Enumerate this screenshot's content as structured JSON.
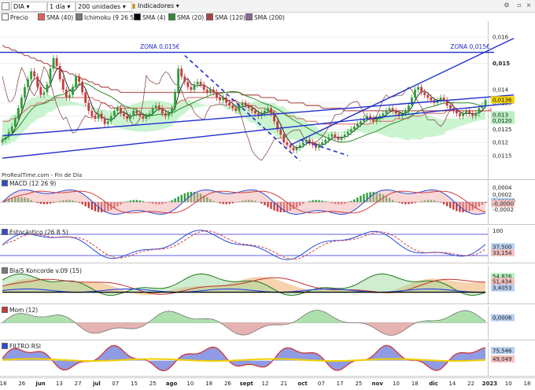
{
  "toolbar": {
    "symbol": "DIA",
    "period": "1 día",
    "units": "200 unidades",
    "indicators": "Indicadores"
  },
  "legend": [
    {
      "label": "Precio",
      "color": "#ffffff"
    },
    {
      "label": "SMA (40)",
      "color": "#e06060"
    },
    {
      "label": "Ichimoku (9 26 52)",
      "color": "#7a7a7a"
    },
    {
      "label": "SMA (4)",
      "color": "#000000"
    },
    {
      "label": "SMA (20)",
      "color": "#2e8b2e"
    },
    {
      "label": "SMA (120)",
      "color": "#b04040"
    },
    {
      "label": "SMA (200)",
      "color": "#8a6a9a"
    }
  ],
  "colors": {
    "up": "#2e9e3a",
    "down": "#c73a3a",
    "trendline": "#1f2ecc",
    "cloud_green": "#b8f0c0",
    "cloud_red": "#f4c0c0",
    "highlight": "#f5d400"
  },
  "watermark": "ProRealTime.com - Fin de Día",
  "x_axis_labels": [
    "18",
    "26",
    "jun",
    "13",
    "27",
    "jul",
    "07",
    "15",
    "25",
    "ago",
    "10",
    "18",
    "26",
    "sept",
    "12",
    "21",
    "oct",
    "07",
    "17",
    "25",
    "nov",
    "10",
    "18",
    "dic",
    "14",
    "22",
    "2023",
    "10",
    "18"
  ],
  "chart_data": [
    {
      "id": "price",
      "type": "candlestick",
      "title": "DIA",
      "ylim": [
        0.0106,
        0.0166
      ],
      "ticks": [
        "0,016",
        "0,015",
        "0,014",
        "0,0135",
        "0,013",
        "0,0125",
        "0,012",
        "0,0115"
      ],
      "tick_values": [
        0.016,
        0.015,
        0.014,
        0.0135,
        0.013,
        0.0125,
        0.012,
        0.0115
      ],
      "value_labels": [
        {
          "text": "0,0136",
          "value": 0.01362,
          "bg": "#f5d400"
        },
        {
          "text": "0,013",
          "value": 0.01305,
          "bg": "#b8f0c0"
        },
        {
          "text": "0,0120",
          "value": 0.01283,
          "bg": "#b8f0c0"
        }
      ],
      "annotations": [
        {
          "text": "ZONA 0,015€",
          "x": 45,
          "y": 0.01555
        },
        {
          "text": "ZONA 0,015€",
          "x": 142,
          "y": 0.01555
        }
      ],
      "horizontal_lines": [
        {
          "y": 0.01542,
          "color": "#1f2ecc"
        }
      ],
      "trendlines": [
        {
          "x0": 0,
          "y0": 0.0114,
          "x1": 160,
          "y1": 0.0135
        },
        {
          "x0": 0,
          "y0": 0.01225,
          "x1": 160,
          "y1": 0.0138
        },
        {
          "x0": 90,
          "y0": 0.0119,
          "x1": 160,
          "y1": 0.01595
        }
      ],
      "dashed_lines": [
        {
          "x0": 57,
          "y0": 0.0153,
          "x1": 93,
          "y1": 0.0113
        },
        {
          "x0": 93,
          "y0": 0.0121,
          "x1": 108,
          "y1": 0.0115
        }
      ],
      "close": [
        0.0121,
        0.0122,
        0.0124,
        0.0126,
        0.0129,
        0.0133,
        0.0137,
        0.0141,
        0.0144,
        0.0147,
        0.0145,
        0.0141,
        0.0138,
        0.0139,
        0.0142,
        0.0148,
        0.0152,
        0.0149,
        0.0144,
        0.014,
        0.0137,
        0.0138,
        0.0141,
        0.0145,
        0.0143,
        0.0139,
        0.0135,
        0.0132,
        0.013,
        0.0129,
        0.0131,
        0.0129,
        0.0127,
        0.0128,
        0.013,
        0.0132,
        0.0133,
        0.0131,
        0.013,
        0.0129,
        0.013,
        0.0132,
        0.0131,
        0.013,
        0.0129,
        0.013,
        0.0131,
        0.0133,
        0.0134,
        0.0133,
        0.0131,
        0.013,
        0.0131,
        0.0133,
        0.0139,
        0.0148,
        0.0145,
        0.0143,
        0.0141,
        0.014,
        0.0142,
        0.0143,
        0.0142,
        0.014,
        0.0139,
        0.014,
        0.0139,
        0.0137,
        0.0136,
        0.0137,
        0.0135,
        0.0134,
        0.0133,
        0.0132,
        0.0134,
        0.0135,
        0.0134,
        0.0133,
        0.0132,
        0.0131,
        0.013,
        0.0131,
        0.0132,
        0.0133,
        0.0131,
        0.0128,
        0.0125,
        0.0123,
        0.012,
        0.0119,
        0.0118,
        0.0117,
        0.0118,
        0.0119,
        0.012,
        0.0121,
        0.012,
        0.0119,
        0.0118,
        0.0119,
        0.012,
        0.0121,
        0.0122,
        0.0123,
        0.0122,
        0.0121,
        0.0122,
        0.0123,
        0.0124,
        0.0125,
        0.0126,
        0.0127,
        0.0128,
        0.0129,
        0.013,
        0.0129,
        0.0128,
        0.0129,
        0.013,
        0.0131,
        0.0132,
        0.0133,
        0.0132,
        0.0131,
        0.013,
        0.0131,
        0.0132,
        0.0134,
        0.0137,
        0.014,
        0.0141,
        0.0139,
        0.0138,
        0.0137,
        0.0136,
        0.0135,
        0.0136,
        0.0137,
        0.0136,
        0.0134,
        0.0133,
        0.0132,
        0.0131,
        0.013,
        0.0131,
        0.0132,
        0.0131,
        0.013,
        0.0131,
        0.0133,
        0.0134,
        0.0136
      ],
      "sma40": [
        0.0128,
        0.0128,
        0.0128,
        0.0129,
        0.0129,
        0.013,
        0.0131,
        0.0132,
        0.0133,
        0.0134,
        0.0134,
        0.0135,
        0.0135,
        0.0135,
        0.0136,
        0.0136,
        0.0136,
        0.0137,
        0.0137,
        0.0137,
        0.0137,
        0.0137,
        0.0137,
        0.0137,
        0.0137,
        0.0137,
        0.0137,
        0.0137,
        0.0137,
        0.0136,
        0.0136,
        0.0135,
        0.0135,
        0.0134,
        0.0134,
        0.0133,
        0.0133,
        0.0133,
        0.0133,
        0.0133,
        0.0133,
        0.0133,
        0.0133,
        0.0133,
        0.0133,
        0.0133,
        0.0133,
        0.0133,
        0.0133,
        0.0133,
        0.0133,
        0.0133,
        0.0133,
        0.0133,
        0.0134,
        0.0135,
        0.0136,
        0.0136,
        0.0137,
        0.0137,
        0.0137,
        0.0137,
        0.0137,
        0.0137,
        0.0137,
        0.0137,
        0.0137,
        0.0137,
        0.0137,
        0.0137,
        0.0136,
        0.0136,
        0.0136,
        0.0136,
        0.0135,
        0.0135,
        0.0135,
        0.0134,
        0.0134,
        0.0134,
        0.0133,
        0.0133,
        0.0133,
        0.0132,
        0.0132,
        0.0132,
        0.0131,
        0.0131,
        0.0131,
        0.013,
        0.013,
        0.013,
        0.0129,
        0.0129,
        0.0129,
        0.0128,
        0.0128,
        0.0128,
        0.0128,
        0.0127,
        0.0127,
        0.0127,
        0.0127,
        0.0127,
        0.0127,
        0.0127,
        0.0127,
        0.0127,
        0.0127,
        0.0127,
        0.0127,
        0.0127,
        0.0127,
        0.0127,
        0.0127,
        0.0127,
        0.0128,
        0.0128,
        0.0128,
        0.0128,
        0.0128,
        0.0128,
        0.0128,
        0.0129,
        0.0129,
        0.0129,
        0.0129,
        0.0129,
        0.013,
        0.013,
        0.013,
        0.013,
        0.0131,
        0.0131,
        0.0131,
        0.0131,
        0.0131,
        0.0131,
        0.0131,
        0.0132,
        0.0132,
        0.0132,
        0.0132,
        0.0132,
        0.0132,
        0.0132,
        0.0132,
        0.0132,
        0.0132,
        0.0132,
        0.0132,
        0.0132,
        0.0132,
        0.0133
      ],
      "sma120": [
        0.0157,
        0.0156,
        0.0156,
        0.0155,
        0.0155,
        0.0154,
        0.0154,
        0.0153,
        0.0153,
        0.0152,
        0.0152,
        0.0151,
        0.0151,
        0.015,
        0.015,
        0.0149,
        0.0149,
        0.0148,
        0.0148,
        0.0147,
        0.0147,
        0.0146,
        0.0146,
        0.0145,
        0.0145,
        0.0144,
        0.0144,
        0.0143,
        0.0143,
        0.0142,
        0.0142,
        0.0141,
        0.0141,
        0.0141,
        0.014,
        0.014,
        0.014,
        0.0139,
        0.0139,
        0.0139,
        0.0139,
        0.0139,
        0.0139,
        0.0139,
        0.0139,
        0.0139,
        0.0139,
        0.0139,
        0.0139,
        0.0139,
        0.0139,
        0.0139,
        0.0139,
        0.0139,
        0.0139,
        0.0139,
        0.0139,
        0.0139,
        0.0139,
        0.0139,
        0.0139,
        0.0139,
        0.0139,
        0.0139,
        0.0139,
        0.0139,
        0.0139,
        0.0139,
        0.0139,
        0.0139,
        0.0139,
        0.0139,
        0.0139,
        0.0139,
        0.0139,
        0.0138,
        0.0138,
        0.0138,
        0.0138,
        0.0138,
        0.0138,
        0.0137,
        0.0137,
        0.0137,
        0.0137,
        0.0137,
        0.0136,
        0.0136,
        0.0136,
        0.0136,
        0.0135,
        0.0135,
        0.0135,
        0.0135,
        0.0135,
        0.0134,
        0.0134,
        0.0134,
        0.0134,
        0.0134,
        0.0133,
        0.0133,
        0.0133,
        0.0133,
        0.0133,
        0.0133,
        0.0133,
        0.0132,
        0.0132,
        0.0132,
        0.0132,
        0.0132,
        0.0132,
        0.0132,
        0.0132,
        0.0132,
        0.0132,
        0.0132,
        0.0132,
        0.0132,
        0.0132,
        0.0132,
        0.0132,
        0.0132,
        0.0132,
        0.0132,
        0.0132,
        0.0132,
        0.0132,
        0.0132,
        0.0132,
        0.0132,
        0.0132,
        0.0132,
        0.0132,
        0.0132,
        0.0132,
        0.0132,
        0.0132,
        0.0132,
        0.0132,
        0.0132,
        0.0132,
        0.0132,
        0.0132,
        0.0132,
        0.0132,
        0.0132,
        0.0132,
        0.0132,
        0.0132,
        0.0132,
        0.0132,
        0.0132
      ]
    },
    {
      "id": "macd",
      "type": "histogram+lines",
      "title": "MACD (12 26 9)",
      "ylim": [
        -0.0006,
        0.0006
      ],
      "ticks": [
        "0,0004",
        "0,0002",
        "0,0000",
        "-0,0002"
      ],
      "tick_values": [
        0.0004,
        0.0002,
        0.0,
        -0.0002
      ],
      "value_labels": [
        {
          "text": "0,00000",
          "value": 2e-05,
          "bg": "#b8d0f0"
        },
        {
          "text": "-0,0000",
          "value": -4e-05,
          "bg": "#f4c0c0"
        }
      ]
    },
    {
      "id": "stoch",
      "type": "line",
      "title": "Estocástico (26 8 5)",
      "ylim": [
        0,
        100
      ],
      "ticks": [
        "100"
      ],
      "tick_values": [
        100
      ],
      "value_labels": [
        {
          "text": "37,500",
          "value": 45,
          "bg": "#b8d0f0"
        },
        {
          "text": "33,154",
          "value": 28,
          "bg": "#f4c0c0"
        }
      ],
      "levels": [
        80,
        20
      ]
    },
    {
      "id": "koncorde",
      "type": "area",
      "title": "Blai5 Koncorde v.09 (15)",
      "ylim": [
        -40,
        100
      ],
      "value_labels": [
        {
          "text": "54,826",
          "value": 60,
          "bg": "#b8f0c0"
        },
        {
          "text": "51,434",
          "value": 42,
          "bg": "#f4c0c0"
        },
        {
          "text": "3,4053",
          "value": 18,
          "bg": "#b8d0f0"
        }
      ]
    },
    {
      "id": "mom",
      "type": "area",
      "title": "Mom (12)",
      "ylim": [
        -0.002,
        0.002
      ],
      "value_labels": [
        {
          "text": "0,0006",
          "value": 0.0006,
          "bg": "#b8d0f0"
        }
      ]
    },
    {
      "id": "filtro_rsi",
      "type": "line",
      "title": "FILTRO RSI",
      "ylim": [
        0,
        100
      ],
      "value_labels": [
        {
          "text": "75,546",
          "value": 75,
          "bg": "#b8d0f0"
        },
        {
          "text": "49,049",
          "value": 50,
          "bg": "#f4c0c0"
        }
      ]
    }
  ]
}
